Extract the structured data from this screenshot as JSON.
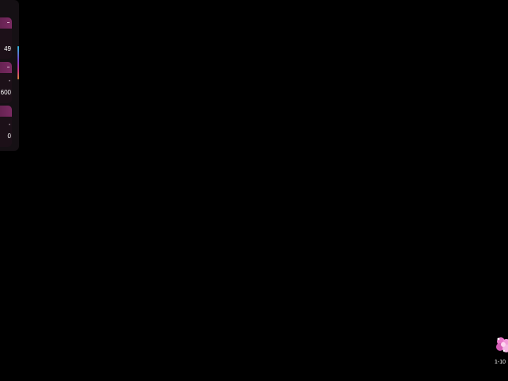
{
  "side_panel": {
    "cards": [
      {
        "value": "49",
        "label": ""
      },
      {
        "value": "600",
        "label": ""
      },
      {
        "value": "0",
        "label": ""
      }
    ],
    "scrollbar_colors": [
      "#2fb6d6",
      "#7a3cc8",
      "#c6357a",
      "#d98a3a"
    ]
  },
  "corner_widget": {
    "icon": "flower-icon",
    "range_text": "1-10"
  },
  "colors": {
    "background": "#000000",
    "card_header": "#6a2456",
    "accent_pink": "#e877c8"
  }
}
